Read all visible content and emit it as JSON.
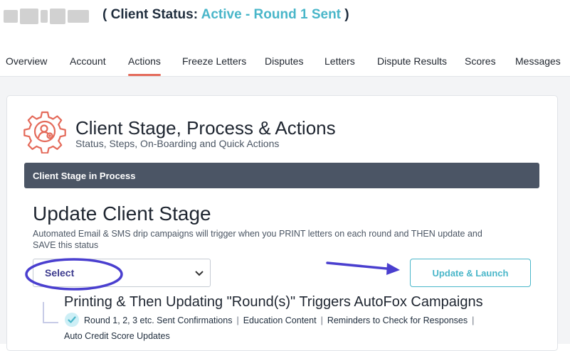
{
  "header": {
    "status_label": "( Client Status:",
    "status_value": "Active - Round 1 Sent",
    "status_close": ")"
  },
  "tabs": [
    {
      "label": "Overview"
    },
    {
      "label": "Account"
    },
    {
      "label": "Actions",
      "active": true
    },
    {
      "label": "Freeze Letters"
    },
    {
      "label": "Disputes"
    },
    {
      "label": "Letters"
    },
    {
      "label": "Dispute Results"
    },
    {
      "label": "Scores"
    },
    {
      "label": "Messages"
    }
  ],
  "card": {
    "title": "Client Stage, Process & Actions",
    "subtitle": "Status, Steps, On-Boarding and Quick Actions",
    "stage_bar": "Client Stage in Process",
    "update_title": "Update Client Stage",
    "update_desc": "Automated Email & SMS drip campaigns will trigger when you PRINT letters on each round and THEN update and SAVE this status",
    "select_value": "Select",
    "launch_button": "Update & Launch",
    "triggers_title": "Printing & Then Updating \"Round(s)\" Triggers AutoFox Campaigns",
    "features": [
      "Round 1, 2, 3 etc. Sent Confirmations",
      "Education Content",
      "Reminders to Check for Responses",
      "Auto Credit Score Updates"
    ]
  },
  "colors": {
    "accent_teal": "#49b6c9",
    "tab_active": "#e46a5a",
    "stage_bar": "#4b5565",
    "annotation_purple": "#4a3fcf"
  }
}
